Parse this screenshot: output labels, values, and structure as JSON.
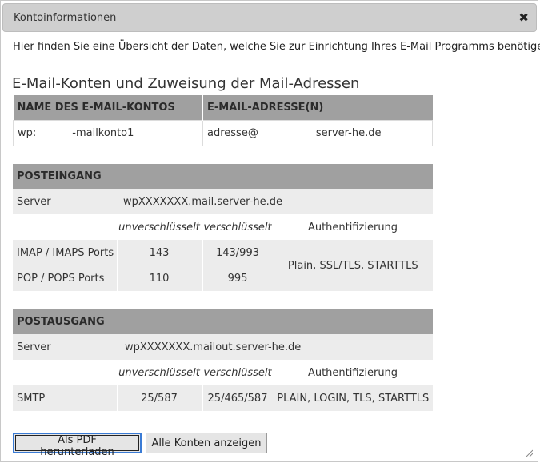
{
  "dialog": {
    "title": "Kontoinformationen"
  },
  "intro": "Hier finden Sie eine Übersicht der Daten, welche Sie zur Einrichtung Ihres E-Mail Programms benötigen.",
  "accounts": {
    "heading": "E-Mail-Konten und Zuweisung der Mail-Adressen",
    "col_account": "NAME DES E-MAIL-KONTOS",
    "col_address": "E-MAIL-ADRESSE(N)",
    "account_prefix": "wp:",
    "account_suffix": "-mailkonto1",
    "address_prefix": "adresse@",
    "address_suffix": "server-he.de"
  },
  "incoming": {
    "heading": "POSTEINGANG",
    "server_label": "Server",
    "server_value": "wpXXXXXXX.mail.server-he.de",
    "col_unencrypted": "unverschlüsselt",
    "col_encrypted": "verschlüsselt",
    "col_auth": "Authentifizierung",
    "rows": [
      {
        "label": "IMAP / IMAPS Ports",
        "unencrypted": "143",
        "encrypted": "143/993"
      },
      {
        "label": "POP / POPS Ports",
        "unencrypted": "110",
        "encrypted": "995"
      }
    ],
    "auth_value": "Plain, SSL/TLS, STARTTLS"
  },
  "outgoing": {
    "heading": "POSTAUSGANG",
    "server_label": "Server",
    "server_value": "wpXXXXXXX.mailout.server-he.de",
    "col_unencrypted": "unverschlüsselt",
    "col_encrypted": "verschlüsselt",
    "col_auth": "Authentifizierung",
    "row": {
      "label": "SMTP",
      "unencrypted": "25/587",
      "encrypted": "25/465/587",
      "auth": "PLAIN, LOGIN, TLS, STARTTLS"
    }
  },
  "buttons": {
    "pdf": "Als PDF herunterladen",
    "all_accounts": "Alle Konten anzeigen"
  }
}
